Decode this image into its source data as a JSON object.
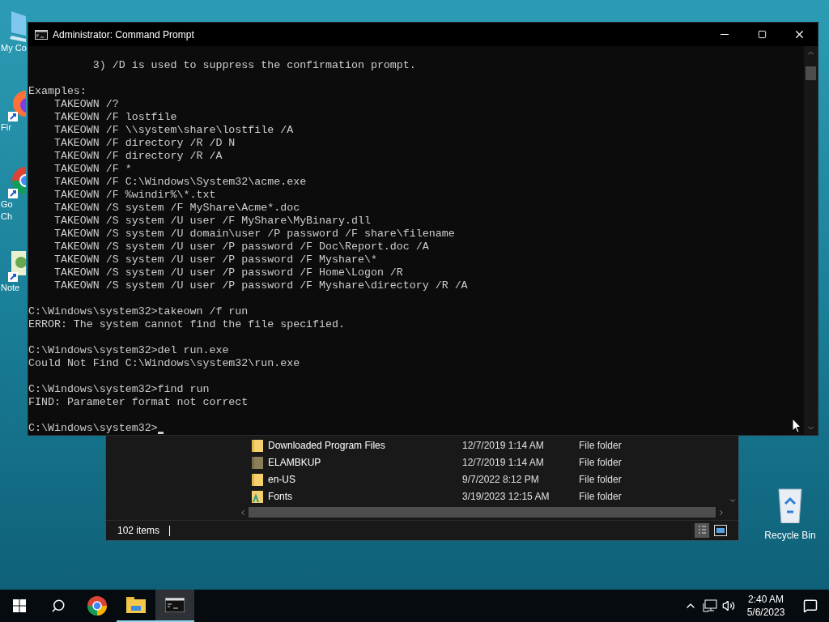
{
  "desktop_icons": [
    {
      "kind": "computer",
      "label_lines": [
        "My Co"
      ]
    },
    {
      "kind": "firefox",
      "label_lines": [
        "Fir"
      ]
    },
    {
      "kind": "chrome",
      "label_lines": [
        "Go",
        "Ch"
      ]
    },
    {
      "kind": "notepad",
      "label_lines": [
        "Note"
      ]
    }
  ],
  "recycle_bin": {
    "label": "Recycle Bin"
  },
  "explorer": {
    "rows": [
      {
        "kind": "folder",
        "name": "Downloaded Program Files",
        "date": "12/7/2019 1:14 AM",
        "type": "File folder"
      },
      {
        "kind": "hidden_folder",
        "name": "ELAMBKUP",
        "date": "12/7/2019 1:14 AM",
        "type": "File folder"
      },
      {
        "kind": "folder",
        "name": "en-US",
        "date": "9/7/2022 8:12 PM",
        "type": "File folder"
      },
      {
        "kind": "fonts_folder",
        "name": "Fonts",
        "date": "3/19/2023 12:15 AM",
        "type": "File folder"
      }
    ],
    "status": "102 items"
  },
  "console": {
    "title": "Administrator: Command Prompt",
    "blocks": [
      [
        "          3) /D is used to suppress the confirmation prompt."
      ],
      [
        "Examples:",
        "    TAKEOWN /?",
        "    TAKEOWN /F lostfile",
        "    TAKEOWN /F \\\\system\\share\\lostfile /A",
        "    TAKEOWN /F directory /R /D N",
        "    TAKEOWN /F directory /R /A",
        "    TAKEOWN /F *",
        "    TAKEOWN /F C:\\Windows\\System32\\acme.exe",
        "    TAKEOWN /F %windir%\\*.txt",
        "    TAKEOWN /S system /F MyShare\\Acme*.doc",
        "    TAKEOWN /S system /U user /F MyShare\\MyBinary.dll",
        "    TAKEOWN /S system /U domain\\user /P password /F share\\filename",
        "    TAKEOWN /S system /U user /P password /F Doc\\Report.doc /A",
        "    TAKEOWN /S system /U user /P password /F Myshare\\*",
        "    TAKEOWN /S system /U user /P password /F Home\\Logon /R",
        "    TAKEOWN /S system /U user /P password /F Myshare\\directory /R /A"
      ],
      [
        "C:\\Windows\\system32>takeown /f run",
        "ERROR: The system cannot find the file specified."
      ],
      [
        "C:\\Windows\\system32>del run.exe",
        "Could Not Find C:\\Windows\\system32\\run.exe"
      ],
      [
        "C:\\Windows\\system32>find run",
        "FIND: Parameter format not correct"
      ]
    ],
    "prompt": "C:\\Windows\\system32>"
  },
  "taskbar": {
    "items": [
      {
        "kind": "start",
        "running": false,
        "selected": false
      },
      {
        "kind": "search",
        "running": false,
        "selected": false
      },
      {
        "kind": "chrome",
        "running": false,
        "selected": false
      },
      {
        "kind": "explorer",
        "running": true,
        "selected": false
      },
      {
        "kind": "cmd",
        "running": true,
        "selected": true
      }
    ],
    "time": "2:40 AM",
    "date": "5/6/2023"
  }
}
